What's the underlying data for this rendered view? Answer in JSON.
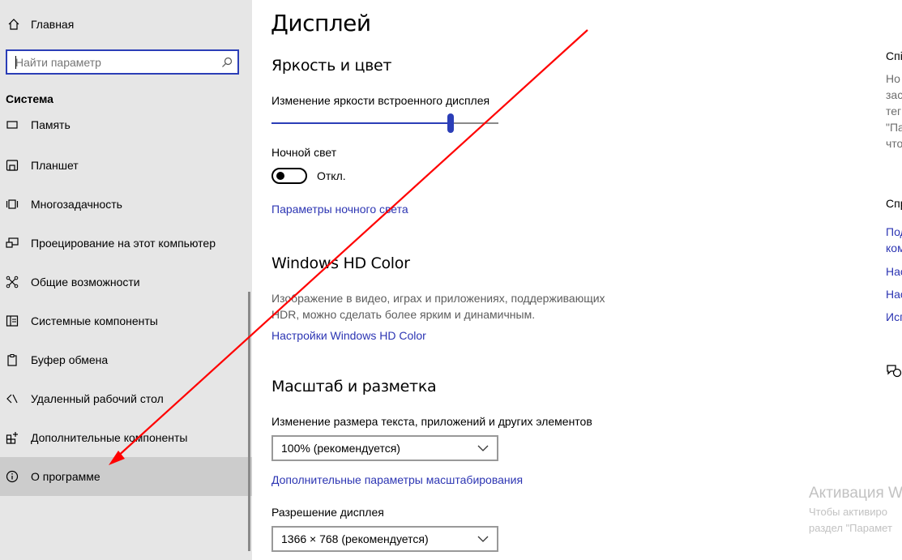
{
  "sidebar": {
    "home_label": "Главная",
    "search_placeholder": "Найти параметр",
    "section_title": "Система",
    "clipped_item_label": "Память",
    "items": [
      {
        "label": "Планшет",
        "icon": "tablet-icon"
      },
      {
        "label": "Многозадачность",
        "icon": "multitasking-icon"
      },
      {
        "label": "Проецирование на этот компьютер",
        "icon": "projecting-icon"
      },
      {
        "label": "Общие возможности",
        "icon": "shared-experiences-icon"
      },
      {
        "label": "Системные компоненты",
        "icon": "system-components-icon"
      },
      {
        "label": "Буфер обмена",
        "icon": "clipboard-icon"
      },
      {
        "label": "Удаленный рабочий стол",
        "icon": "remote-desktop-icon"
      },
      {
        "label": "Дополнительные компоненты",
        "icon": "optional-features-icon"
      },
      {
        "label": "О программе",
        "icon": "info-icon",
        "selected": true
      }
    ]
  },
  "main": {
    "title": "Дисплей",
    "brightness_heading": "Яркость и цвет",
    "brightness_label": "Изменение яркости встроенного дисплея",
    "brightness_level": 0.79,
    "night_light_label": "Ночной свет",
    "night_light_state": "Откл.",
    "night_light_link": "Параметры ночного света",
    "hdr_heading": "Windows HD Color",
    "hdr_desc_line1": "Изображение в видео, играх и приложениях, поддерживающих",
    "hdr_desc_line2": "HDR, можно сделать более ярким и динамичным.",
    "hdr_link": "Настройки Windows HD Color",
    "scale_heading": "Масштаб и разметка",
    "scale_label": "Изменение размера текста, приложений и других элементов",
    "scale_value": "100% (рекомендуется)",
    "scale_link": "Дополнительные параметры масштабирования",
    "resolution_label": "Разрешение дисплея",
    "resolution_value": "1366 × 768 (рекомендуется)"
  },
  "right_column": {
    "heading1": "Спі",
    "lines": [
      "Но",
      "зас",
      "тег",
      "\"Па",
      "что"
    ],
    "heading2": "Спр",
    "links": [
      "Под",
      "ком",
      "Нас",
      "Нас",
      "Исг"
    ]
  },
  "activation": {
    "title": "Активация W",
    "line1": "Чтобы активиро",
    "line2": "раздел \"Парамет"
  },
  "colors": {
    "accent": "#2b3eb7",
    "link": "#2c35b3",
    "sidebar_bg": "#e6e6e6",
    "selected_bg": "#cccccc",
    "annotation_arrow": "#ff0000"
  }
}
